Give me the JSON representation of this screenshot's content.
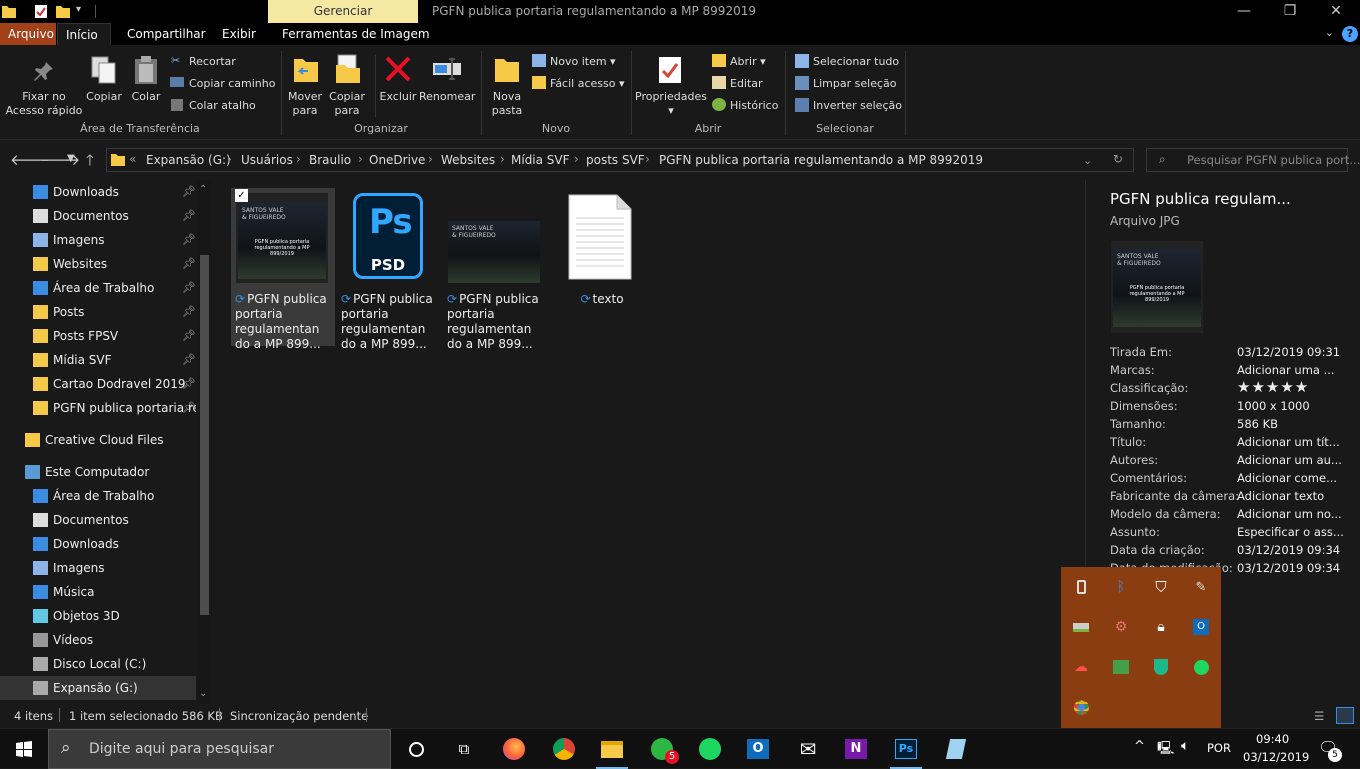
{
  "window": {
    "title": "PGFN publica portaria regulamentando a MP 8992019",
    "context_tab": "Gerenciar"
  },
  "tabs": [
    "Arquivo",
    "Início",
    "Compartilhar",
    "Exibir",
    "Ferramentas de Imagem"
  ],
  "ribbon": {
    "clipboard": {
      "pin": "Fixar no\nAcesso rápido",
      "copy": "Copiar",
      "paste": "Colar",
      "cut": "Recortar",
      "copy_path": "Copiar caminho",
      "paste_shortcut": "Colar atalho",
      "label": "Área de Transferência"
    },
    "organize": {
      "move": "Mover\npara",
      "copyto": "Copiar\npara",
      "delete": "Excluir",
      "rename": "Renomear",
      "label": "Organizar"
    },
    "new": {
      "folder": "Nova\npasta",
      "item": "Novo item",
      "easy": "Fácil acesso",
      "label": "Novo"
    },
    "open": {
      "props": "Propriedades",
      "open": "Abrir",
      "edit": "Editar",
      "history": "Histórico",
      "label": "Abrir"
    },
    "select": {
      "all": "Selecionar tudo",
      "none": "Limpar seleção",
      "invert": "Inverter seleção",
      "label": "Selecionar"
    }
  },
  "breadcrumb": [
    "Expansão (G:)",
    "Usuários",
    "Braulio",
    "OneDrive",
    "Websites",
    "Mídia SVF",
    "posts SVF",
    "PGFN publica portaria regulamentando a MP 8992019"
  ],
  "search_placeholder": "Pesquisar PGFN publica port...",
  "nav": {
    "quick": [
      "Downloads",
      "Documentos",
      "Imagens",
      "Websites",
      "Área de Trabalho",
      "Posts",
      "Posts FPSV",
      "Mídia SVF",
      "Cartao Dodravel 2019",
      "PGFN publica portaria re"
    ],
    "cloud": "Creative Cloud Files",
    "pc": "Este Computador",
    "pc_items": [
      "Área de Trabalho",
      "Documentos",
      "Downloads",
      "Imagens",
      "Música",
      "Objetos 3D",
      "Vídeos",
      "Disco Local (C:)",
      "Expansão (G:)"
    ]
  },
  "files": [
    {
      "name": "PGFN publica portaria regulamentan do a MP 899...",
      "type": "jpg-thumb"
    },
    {
      "name": "PGFN publica portaria regulamentan do a MP 899...",
      "type": "psd"
    },
    {
      "name": "PGFN publica portaria regulamentan do a MP 899...",
      "type": "jpg-thumb"
    },
    {
      "name": "texto",
      "type": "txt"
    }
  ],
  "thumb_text": {
    "brand": "SANTOS VALE\n& FIGUEIREDO",
    "caption": "PGFN publica portaria\nregulamentando a MP\n899/2019"
  },
  "psd": {
    "ps": "Ps",
    "ext": "PSD"
  },
  "details": {
    "title": "PGFN publica regulam...",
    "type": "Arquivo JPG",
    "props": [
      {
        "k": "Tirada Em:",
        "v": "03/12/2019 09:31"
      },
      {
        "k": "Marcas:",
        "v": "Adicionar uma ..."
      },
      {
        "k": "Classificação:",
        "v": "★★★★★"
      },
      {
        "k": "Dimensões:",
        "v": "1000 x 1000"
      },
      {
        "k": "Tamanho:",
        "v": "586 KB"
      },
      {
        "k": "Título:",
        "v": "Adicionar um tít..."
      },
      {
        "k": "Autores:",
        "v": "Adicionar um au..."
      },
      {
        "k": "Comentários:",
        "v": "Adicionar come..."
      },
      {
        "k": "Fabricante da câmera:",
        "v": "Adicionar texto"
      },
      {
        "k": "Modelo da câmera:",
        "v": "Adicionar um no..."
      },
      {
        "k": "Assunto:",
        "v": "Especificar o ass..."
      },
      {
        "k": "Data da criação:",
        "v": "03/12/2019 09:34"
      },
      {
        "k": "Data de modificação:",
        "v": "03/12/2019 09:34"
      }
    ]
  },
  "status": {
    "count": "4 itens",
    "selected": "1 item selecionado  586 KB",
    "sync": "Sincronização pendente"
  },
  "taskbar": {
    "search": "Digite aqui para pesquisar",
    "lang": "POR",
    "time": "09:40",
    "date": "03/12/2019",
    "notif": "5",
    "chrome_badge": "5"
  },
  "colors": {
    "accent": "#a1411a",
    "tray": "#8a3d10",
    "selection": "#3a3a3a",
    "ps_blue": "#31a8ff"
  }
}
